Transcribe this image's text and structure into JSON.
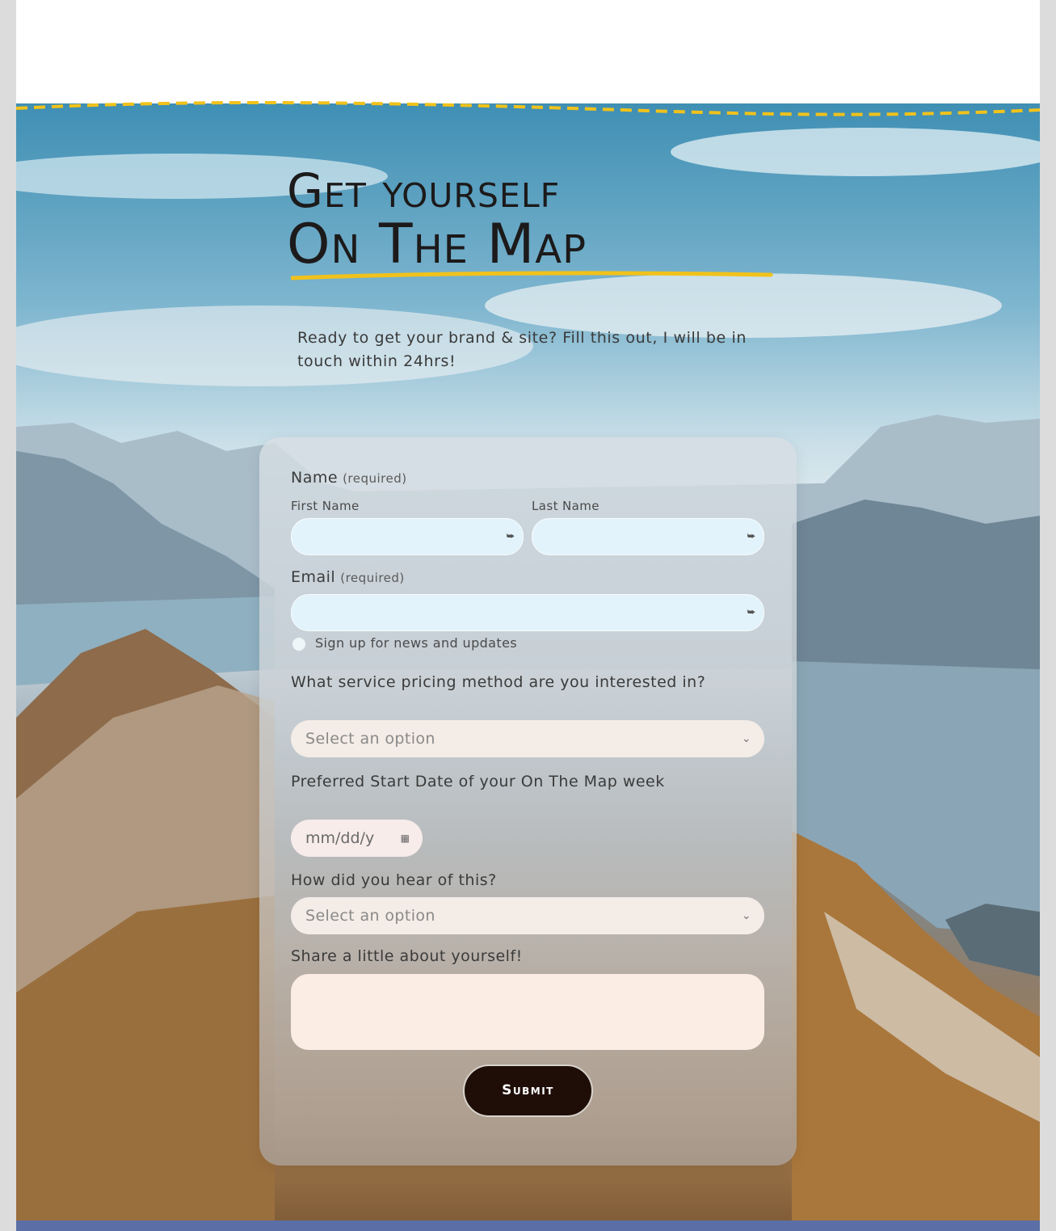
{
  "hero": {
    "title_line1": "Get yourself",
    "title_line2": "On The Map",
    "intro": "Ready to get your brand & site? Fill this out, I will be in touch within 24hrs!"
  },
  "form": {
    "name_label": "Name",
    "name_required": "(required)",
    "first_name_label": "First Name",
    "last_name_label": "Last Name",
    "email_label": "Email",
    "email_required": "(required)",
    "newsletter_label": "Sign up for news and updates",
    "pricing_label": "What service pricing method are you interested in?",
    "pricing_placeholder": "Select an option",
    "start_date_label": "Preferred Start Date of your On The Map week",
    "start_date_placeholder": "mm/dd/y",
    "hear_label": "How did you hear of this?",
    "hear_placeholder": "Select an option",
    "about_label": "Share a little about yourself!",
    "submit_label": "Submit"
  },
  "icons": {
    "field_indicator": "autofill-icon",
    "dropdown": "chevron-down-icon",
    "calendar": "calendar-icon"
  },
  "colors": {
    "accent_yellow": "#f1c21b",
    "submit_bg": "#1f0e08"
  }
}
